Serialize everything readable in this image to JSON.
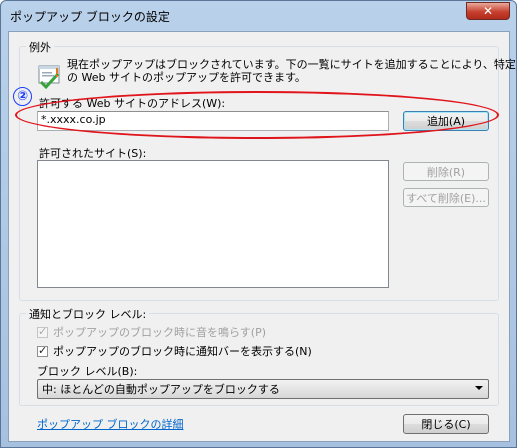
{
  "window": {
    "title": "ポップアップ ブロックの設定"
  },
  "exceptions": {
    "legend": "例外",
    "info_line1": "現在ポップアップはブロックされています。下の一覧にサイトを追加することにより、特定",
    "info_line2": "の Web サイトのポップアップを許可できます。",
    "address_label": "許可する Web サイトのアドレス(W):",
    "address_value": "*.xxxx.co.jp",
    "add_button": "追加(A)",
    "allowed_label": "許可されたサイト(S):",
    "remove_button": "削除(R)",
    "remove_all_button": "すべて削除(E)...",
    "annotation_number": "②"
  },
  "notification": {
    "legend": "通知とブロック レベル:",
    "sound_checkbox": "ポップアップのブロック時に音を鳴らす(P)",
    "infobar_checkbox": "ポップアップのブロック時に通知バーを表示する(N)",
    "level_label": "ブロック レベル(B):",
    "level_value": "中: ほとんどの自動ポップアップをブロックする"
  },
  "footer": {
    "details_link": "ポップアップ ブロックの詳細",
    "close_button": "閉じる(C)"
  }
}
